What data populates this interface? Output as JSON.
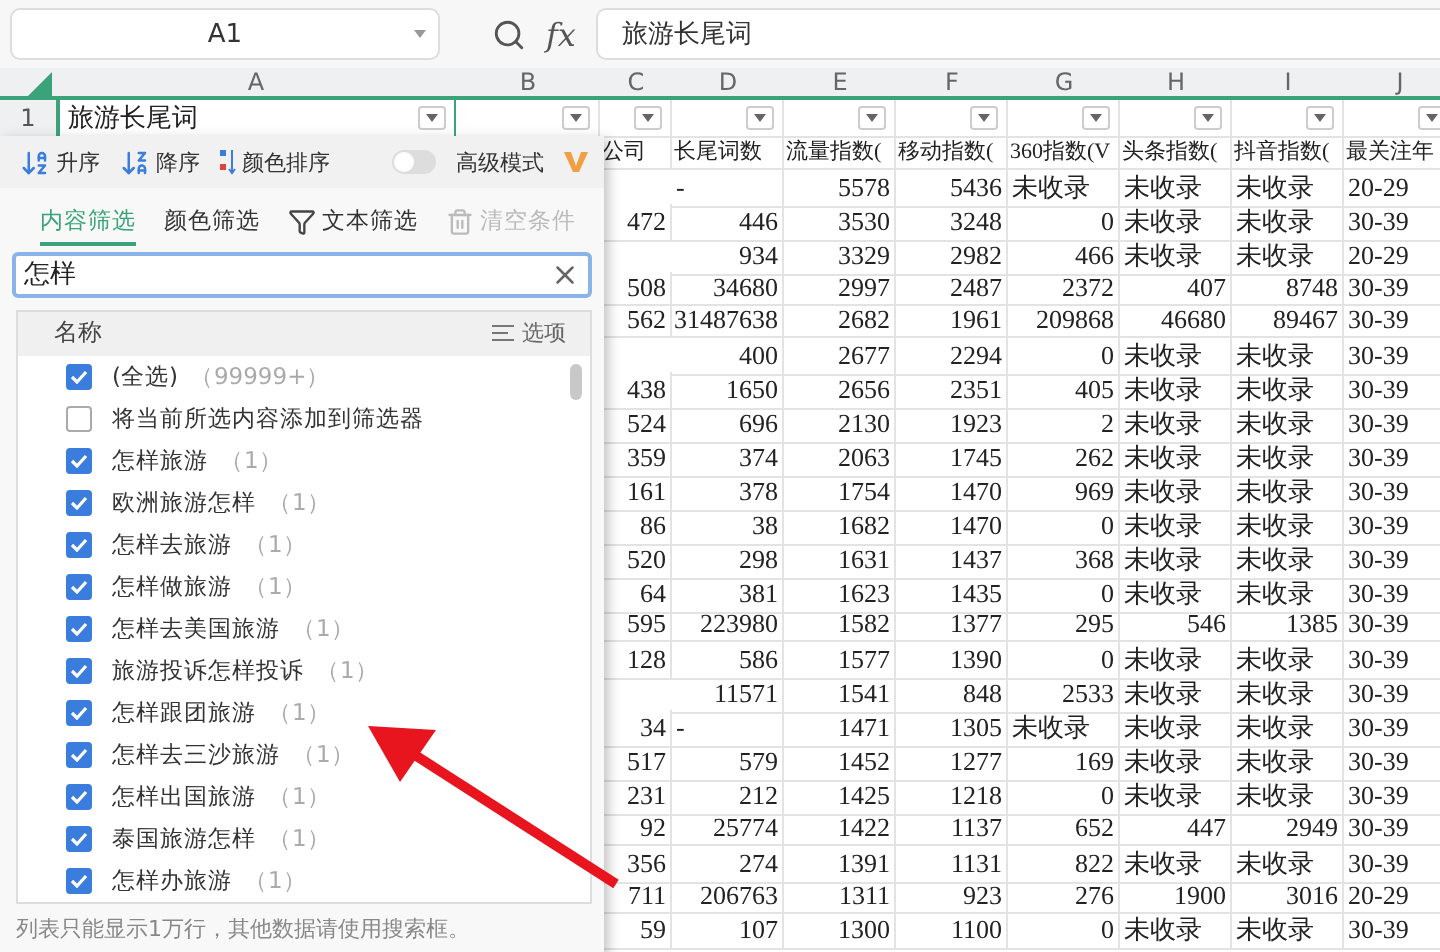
{
  "formula_bar": {
    "cell_ref": "A1",
    "fx_label": "fx",
    "formula": "旅游长尾词"
  },
  "sheet": {
    "column_letters": [
      "A",
      "B",
      "C",
      "D",
      "E",
      "F",
      "G",
      "H",
      "I",
      "J"
    ],
    "first_row": {
      "number": "1",
      "a1": "旅游长尾词"
    },
    "header_row": [
      "公司",
      "长尾词数",
      "流量指数(",
      "移动指数(",
      "360指数(V",
      "头条指数(",
      "抖音指数(",
      "最关注年"
    ],
    "rows": [
      [
        "",
        "-",
        "5578",
        "5436",
        "未收录",
        "未收录",
        "未收录",
        "20-29"
      ],
      [
        "472",
        "446",
        "3530",
        "3248",
        "0",
        "未收录",
        "未收录",
        "30-39"
      ],
      [
        "",
        "934",
        "3329",
        "2982",
        "466",
        "未收录",
        "未收录",
        "20-29"
      ],
      [
        "508",
        "34680",
        "2997",
        "2487",
        "2372",
        "407",
        "8748",
        "30-39"
      ],
      [
        "562",
        "31487638",
        "2682",
        "1961",
        "209868",
        "46680",
        "89467",
        "30-39"
      ],
      [
        "",
        "400",
        "2677",
        "2294",
        "0",
        "未收录",
        "未收录",
        "30-39"
      ],
      [
        "438",
        "1650",
        "2656",
        "2351",
        "405",
        "未收录",
        "未收录",
        "30-39"
      ],
      [
        "524",
        "696",
        "2130",
        "1923",
        "2",
        "未收录",
        "未收录",
        "30-39"
      ],
      [
        "359",
        "374",
        "2063",
        "1745",
        "262",
        "未收录",
        "未收录",
        "30-39"
      ],
      [
        "161",
        "378",
        "1754",
        "1470",
        "969",
        "未收录",
        "未收录",
        "30-39"
      ],
      [
        "86",
        "38",
        "1682",
        "1470",
        "0",
        "未收录",
        "未收录",
        "30-39"
      ],
      [
        "520",
        "298",
        "1631",
        "1437",
        "368",
        "未收录",
        "未收录",
        "30-39"
      ],
      [
        "64",
        "381",
        "1623",
        "1435",
        "0",
        "未收录",
        "未收录",
        "30-39"
      ],
      [
        "595",
        "223980",
        "1582",
        "1377",
        "295",
        "546",
        "1385",
        "30-39"
      ],
      [
        "128",
        "586",
        "1577",
        "1390",
        "0",
        "未收录",
        "未收录",
        "30-39"
      ],
      [
        "",
        "11571",
        "1541",
        "848",
        "2533",
        "未收录",
        "未收录",
        "30-39"
      ],
      [
        "34",
        "-",
        "1471",
        "1305",
        "未收录",
        "未收录",
        "未收录",
        "30-39"
      ],
      [
        "517",
        "579",
        "1452",
        "1277",
        "169",
        "未收录",
        "未收录",
        "30-39"
      ],
      [
        "231",
        "212",
        "1425",
        "1218",
        "0",
        "未收录",
        "未收录",
        "30-39"
      ],
      [
        "92",
        "25774",
        "1422",
        "1137",
        "652",
        "447",
        "2949",
        "30-39"
      ],
      [
        "356",
        "274",
        "1391",
        "1131",
        "822",
        "未收录",
        "未收录",
        "30-39"
      ],
      [
        "711",
        "206763",
        "1311",
        "923",
        "276",
        "1900",
        "3016",
        "20-29"
      ],
      [
        "59",
        "107",
        "1300",
        "1100",
        "0",
        "未收录",
        "未收录",
        "30-39"
      ]
    ]
  },
  "filter_panel": {
    "sort_buttons": [
      {
        "kind": "asc",
        "label": "升序"
      },
      {
        "kind": "desc",
        "label": "降序"
      },
      {
        "kind": "color",
        "label": "颜色排序"
      }
    ],
    "advanced_mode": {
      "label": "高级模式",
      "on": false
    },
    "tabs": [
      {
        "label": "内容筛选",
        "selected": true
      },
      {
        "label": "颜色筛选",
        "selected": false
      }
    ],
    "actions": [
      {
        "kind": "text_filter",
        "label": "文本筛选",
        "disabled": false
      },
      {
        "kind": "clear",
        "label": "清空条件",
        "disabled": true
      }
    ],
    "search": {
      "value": "怎样"
    },
    "list_header": {
      "name": "名称",
      "options": "选项"
    },
    "items": [
      {
        "label": "(全选)",
        "count": "（99999+）",
        "checked": true
      },
      {
        "label": "将当前所选内容添加到筛选器",
        "checked": false
      },
      {
        "label": "怎样旅游",
        "count": "（1）",
        "checked": true
      },
      {
        "label": "欧洲旅游怎样",
        "count": "（1）",
        "checked": true
      },
      {
        "label": "怎样去旅游",
        "count": "（1）",
        "checked": true
      },
      {
        "label": "怎样做旅游",
        "count": "（1）",
        "checked": true
      },
      {
        "label": "怎样去美国旅游",
        "count": "（1）",
        "checked": true
      },
      {
        "label": "旅游投诉怎样投诉",
        "count": "（1）",
        "checked": true
      },
      {
        "label": "怎样跟团旅游",
        "count": "（1）",
        "checked": true
      },
      {
        "label": "怎样去三沙旅游",
        "count": "（1）",
        "checked": true
      },
      {
        "label": "怎样出国旅游",
        "count": "（1）",
        "checked": true
      },
      {
        "label": "泰国旅游怎样",
        "count": "（1）",
        "checked": true
      },
      {
        "label": "怎样办旅游",
        "count": "（1）",
        "checked": true
      }
    ],
    "note": "列表只能显示1万行，其他数据请使用搜索框。"
  }
}
